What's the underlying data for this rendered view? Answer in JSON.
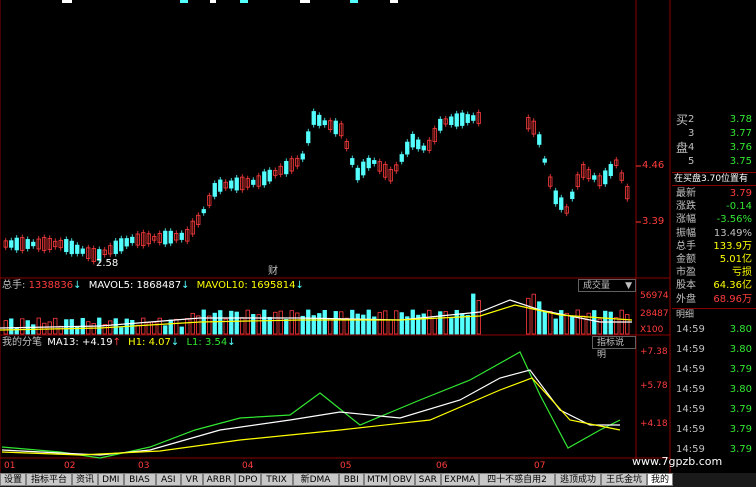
{
  "colors": {
    "up": "#ff3c3c",
    "down": "#54ffff",
    "ma_white": "#ffffff",
    "ma_yellow": "#ffff00",
    "ma_green": "#32e632",
    "grid": "#8b0000",
    "axis_text": "#ff3c3c"
  },
  "price_axis": {
    "high_label": "4.46",
    "low_label": "3.39",
    "low_marker": "2.58",
    "event_marker": "财"
  },
  "volume": {
    "title": "总手:",
    "total": "1338836",
    "mavol5_label": "MAVOL5:",
    "mavol5": "1868487",
    "mavol10_label": "MAVOL10:",
    "mavol10": "1695814",
    "axis_top": "56974",
    "axis_mid": "28487",
    "axis_unit": "X100",
    "button": "成交量"
  },
  "indicator": {
    "name": "我的分笔",
    "ma13_label": "MA13:",
    "ma13": "+4.19",
    "h1_label": "H1:",
    "h1": "4.07",
    "l1_label": "L1:",
    "l1": "3.54",
    "button": "指标说明",
    "axis_top": "+7.38",
    "axis_mid": "+5.78",
    "axis_low": "+4.18"
  },
  "x_axis": [
    "01",
    "02",
    "03",
    "04",
    "05",
    "06",
    "07"
  ],
  "quote_panel": {
    "buy_label_1": "买",
    "buy_label_2": "盘",
    "bids": [
      {
        "level": "2",
        "price": "3.78"
      },
      {
        "level": "3",
        "price": "3.77"
      },
      {
        "level": "4",
        "price": "3.76"
      },
      {
        "level": "5",
        "price": "3.75"
      }
    ],
    "notice": "在买盘3.70位置有",
    "stats": [
      {
        "label": "最新",
        "value": "3.79",
        "color": "#ff3c3c"
      },
      {
        "label": "涨跌",
        "value": "-0.14",
        "color": "#32e632"
      },
      {
        "label": "涨幅",
        "value": "-3.56%",
        "color": "#32e632"
      },
      {
        "label": "振幅",
        "value": "13.49%",
        "color": "#c0c0c0"
      },
      {
        "label": "总手",
        "value": "133.9万",
        "color": "#ffff00"
      },
      {
        "label": "金额",
        "value": "5.01亿",
        "color": "#ffff00"
      },
      {
        "label": "市盈",
        "value": "亏损",
        "color": "#ffff00"
      },
      {
        "label": "股本",
        "value": "64.36亿",
        "color": "#ffff00"
      },
      {
        "label": "外盘",
        "value": "68.96万",
        "color": "#ff3c3c"
      }
    ],
    "details_header": "明细",
    "ticks": [
      {
        "time": "14:59",
        "price": "3.80"
      },
      {
        "time": "14:59",
        "price": "3.80"
      },
      {
        "time": "14:59",
        "price": "3.79"
      },
      {
        "time": "14:59",
        "price": "3.80"
      },
      {
        "time": "14:59",
        "price": "3.79"
      },
      {
        "time": "14:59",
        "price": "3.79"
      },
      {
        "time": "14:59",
        "price": "3.79"
      }
    ]
  },
  "tabs": [
    "设置",
    "指标平台",
    "资讯",
    "DMI",
    "BIAS",
    "ASI",
    "VR",
    "ARBR",
    "DPO",
    "TRIX",
    "新DMA",
    "BBI",
    "MTM",
    "OBV",
    "SAR",
    "EXPMA",
    "四十不惑自用2",
    "逃顶成功",
    "王氏金坑",
    "我的"
  ],
  "watermark": "www.7gpzb.com"
}
